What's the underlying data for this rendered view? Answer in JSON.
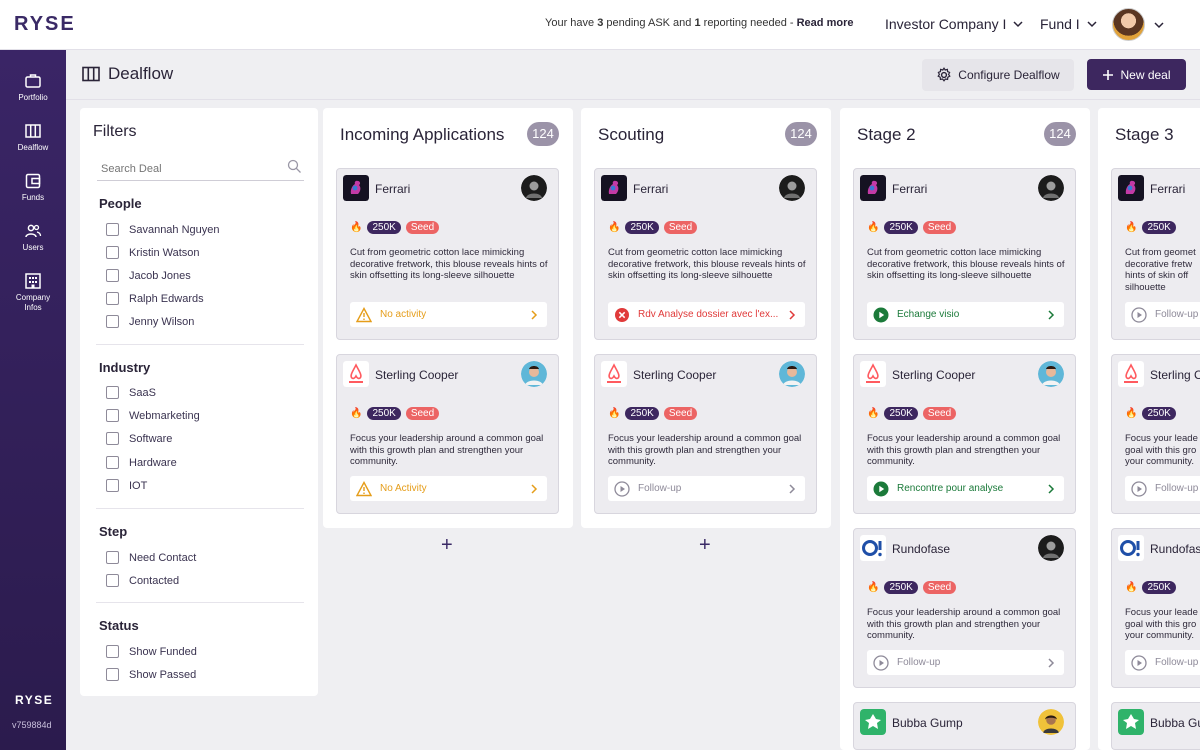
{
  "app": {
    "logo": "RYSE",
    "version": "v759884d"
  },
  "topbar": {
    "notice_prefix": "Your have ",
    "notice_ask_count": "3",
    "notice_mid": " pending ASK and ",
    "notice_report_count": "1",
    "notice_suffix": " reporting needed - ",
    "read_more": "Read more",
    "company": "Investor Company I",
    "fund": "Fund I"
  },
  "sidebar": {
    "items": [
      {
        "label": "Portfolio",
        "icon": "briefcase-icon"
      },
      {
        "label": "Dealflow",
        "icon": "columns-icon"
      },
      {
        "label": "Funds",
        "icon": "wallet-icon"
      },
      {
        "label": "Users",
        "icon": "users-icon"
      },
      {
        "label": "Company",
        "label2": "Infos",
        "icon": "building-icon"
      }
    ]
  },
  "page": {
    "title": "Dealflow",
    "configure_label": "Configure Dealflow",
    "new_deal_label": "New deal"
  },
  "filters": {
    "title": "Filters",
    "search_placeholder": "Search Deal",
    "groups": [
      {
        "title": "People",
        "items": [
          "Savannah Nguyen",
          "Kristin Watson",
          "Jacob Jones",
          "Ralph Edwards",
          "Jenny Wilson"
        ]
      },
      {
        "title": "Industry",
        "items": [
          "SaaS",
          "Webmarketing",
          "Software",
          "Hardware",
          "IOT"
        ]
      },
      {
        "title": "Step",
        "items": [
          "Need Contact",
          "Contacted"
        ]
      },
      {
        "title": "Status",
        "items": [
          "Show Funded",
          "Show Passed"
        ]
      }
    ]
  },
  "columns": [
    {
      "title": "Incoming Applications",
      "count": "124",
      "cards": [
        {
          "name": "Ferrari",
          "amount": "250K",
          "stage": "Seed",
          "desc": "Cut from geometric cotton lace mimicking decorative fretwork, this blouse reveals hints of skin offsetting its long-sleeve silhouette",
          "action": "No activity",
          "status": "warn"
        },
        {
          "name": "Sterling Cooper",
          "amount": "250K",
          "stage": "Seed",
          "desc": "Focus your leadership around a common goal with this growth plan and strengthen your community.",
          "action": "No Activity",
          "status": "warn"
        }
      ]
    },
    {
      "title": "Scouting",
      "count": "124",
      "cards": [
        {
          "name": "Ferrari",
          "amount": "250K",
          "stage": "Seed",
          "desc": "Cut from geometric cotton lace mimicking decorative fretwork, this blouse reveals hints of skin offsetting its long-sleeve silhouette",
          "action": "Rdv Analyse dossier avec l'ex...",
          "status": "error"
        },
        {
          "name": "Sterling Cooper",
          "amount": "250K",
          "stage": "Seed",
          "desc": "Focus your leadership around a common goal with this growth plan and strengthen your community.",
          "action": "Follow-up",
          "status": "neutral"
        }
      ]
    },
    {
      "title": "Stage 2",
      "count": "124",
      "cards": [
        {
          "name": "Ferrari",
          "amount": "250K",
          "stage": "Seed",
          "desc": "Cut from geometric cotton lace mimicking decorative fretwork, this blouse reveals hints of skin offsetting its long-sleeve silhouette",
          "action": "Echange visio",
          "status": "success"
        },
        {
          "name": "Sterling Cooper",
          "amount": "250K",
          "stage": "Seed",
          "desc": "Focus your leadership around a common goal with this growth plan and strengthen your community.",
          "action": "Rencontre pour analyse",
          "status": "success"
        },
        {
          "name": "Rundofase",
          "amount": "250K",
          "stage": "Seed",
          "desc": "Focus your leadership around a common goal with this growth plan and strengthen your community.",
          "action": "Follow-up",
          "status": "neutral"
        },
        {
          "name": "Bubba Gump"
        }
      ]
    },
    {
      "title": "Stage 3",
      "count": "",
      "cards": [
        {
          "name": "Ferrari",
          "amount": "250K",
          "stage": "",
          "desc": "Cut from geomet decorative fretw hints of skin off silhouette",
          "action": "Follow-up",
          "status": "neutral"
        },
        {
          "name": "Sterling C",
          "amount": "250K",
          "stage": "",
          "desc": "Focus your leade goal with this gro your community.",
          "action": "Follow-up",
          "status": "neutral"
        },
        {
          "name": "Rundofas",
          "amount": "250K",
          "stage": "",
          "desc": "Focus your leade goal with this gro your community.",
          "action": "Follow-up",
          "status": "neutral"
        },
        {
          "name": "Bubba Gu"
        }
      ]
    }
  ],
  "add_label": "+"
}
